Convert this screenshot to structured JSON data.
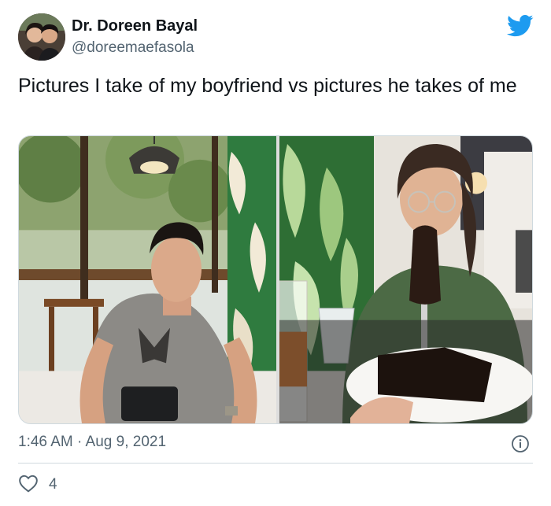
{
  "tweet": {
    "author": {
      "display_name": "Dr. Doreen Bayal",
      "handle": "@doreemaefasola",
      "avatar_icon": "profile-photo"
    },
    "brand_icon": "twitter-bird-icon",
    "brand_color": "#1d9bf0",
    "text": "Pictures I take of my boyfriend vs pictures he takes of me",
    "media": [
      {
        "description_icon": "photo-boyfriend-on-phone"
      },
      {
        "description_icon": "photo-girlfriend-with-cake"
      }
    ],
    "timestamp": "1:46 AM · Aug 9, 2021",
    "likes": "4"
  }
}
